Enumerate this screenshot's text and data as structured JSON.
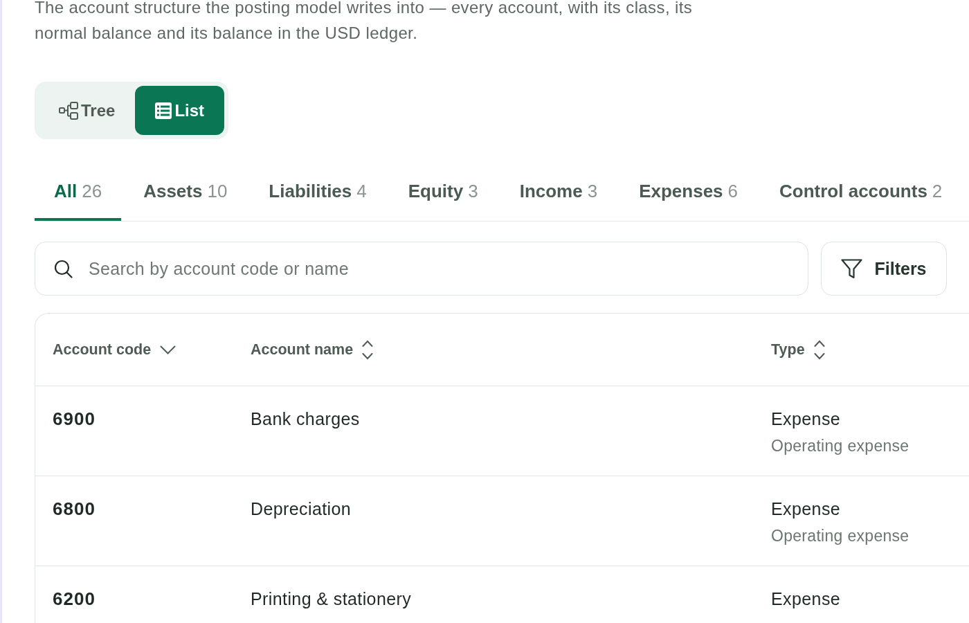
{
  "description": "The account structure the posting model writes into — every account, with its class, its normal balance and its balance in the USD ledger.",
  "view_toggle": [
    {
      "kind": "tree",
      "label": "Tree",
      "selected": false
    },
    {
      "kind": "list",
      "label": "List",
      "selected": true
    }
  ],
  "tabs": [
    {
      "label": "All",
      "count": "26",
      "selected": true
    },
    {
      "label": "Assets",
      "count": "10",
      "selected": false
    },
    {
      "label": "Liabilities",
      "count": "4",
      "selected": false
    },
    {
      "label": "Equity",
      "count": "3",
      "selected": false
    },
    {
      "label": "Income",
      "count": "3",
      "selected": false
    },
    {
      "label": "Expenses",
      "count": "6",
      "selected": false
    },
    {
      "label": "Control accounts",
      "count": "2",
      "selected": false
    }
  ],
  "search": {
    "placeholder": "Search by account code or name"
  },
  "filters_button": {
    "label": "Filters"
  },
  "table": {
    "columns": [
      {
        "label": "Account code",
        "sorted": true
      },
      {
        "label": "Account name",
        "sorted": false
      },
      {
        "label": "Type",
        "sorted": false
      }
    ],
    "rows": [
      {
        "code": "6900",
        "name": "Bank charges",
        "type": "Expense",
        "subtype": "Operating expense"
      },
      {
        "code": "6800",
        "name": "Depreciation",
        "type": "Expense",
        "subtype": "Operating expense"
      },
      {
        "code": "6200",
        "name": "Printing & stationery",
        "type": "Expense"
      }
    ]
  }
}
